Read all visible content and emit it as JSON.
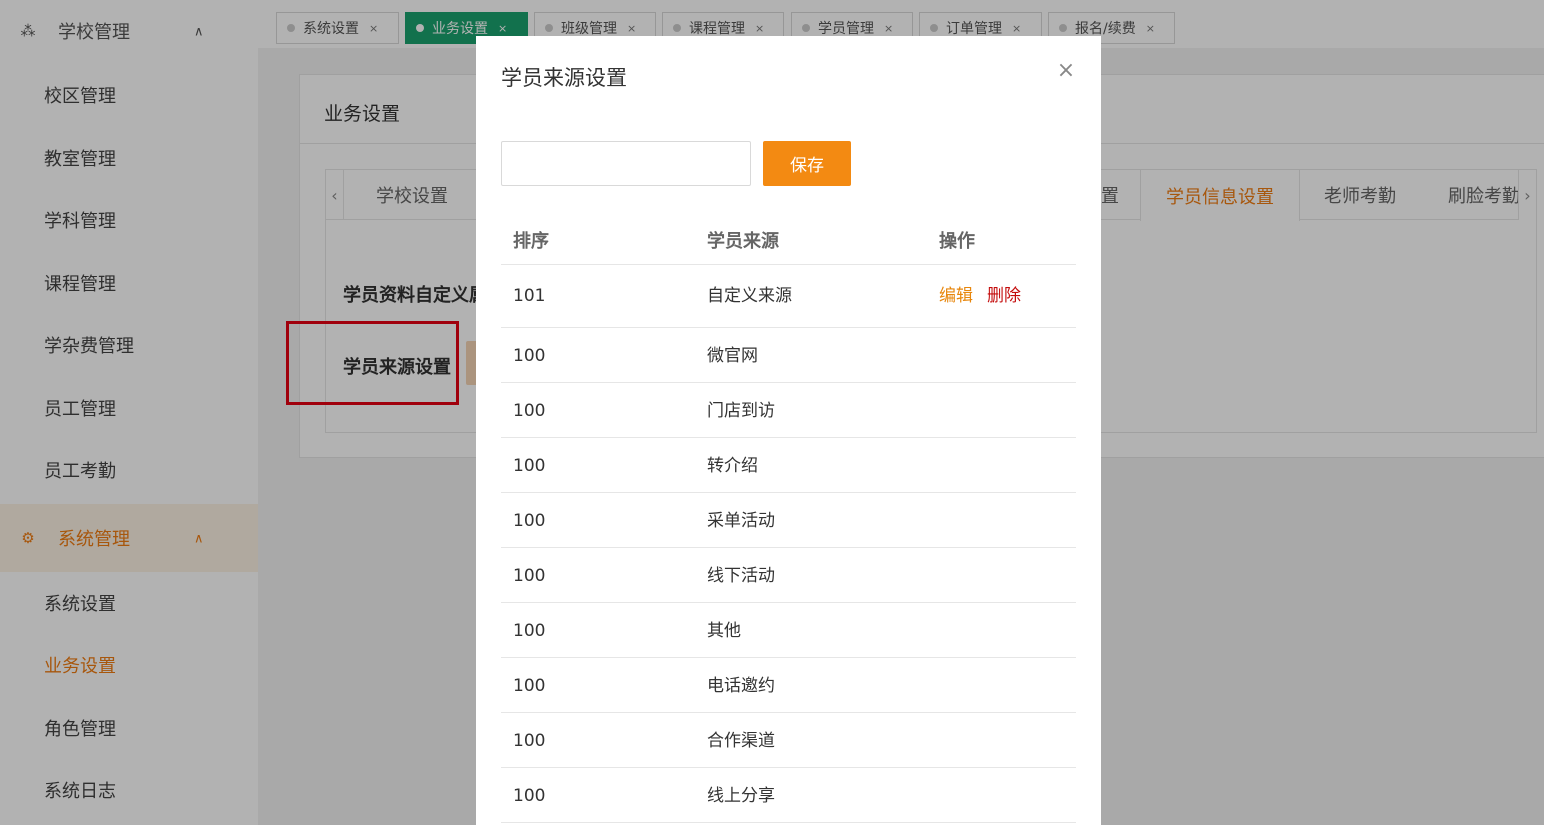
{
  "sidebar": {
    "school_group": {
      "icon": "sitemap-icon",
      "label": "学校管理"
    },
    "school_items": [
      {
        "label": "校区管理"
      },
      {
        "label": "教室管理"
      },
      {
        "label": "学科管理"
      },
      {
        "label": "课程管理"
      },
      {
        "label": "学杂费管理"
      },
      {
        "label": "员工管理"
      },
      {
        "label": "员工考勤"
      }
    ],
    "system_group": {
      "icon": "gear-icon",
      "label": "系统管理"
    },
    "system_items": [
      {
        "label": "系统设置"
      },
      {
        "label": "业务设置",
        "active": true
      },
      {
        "label": "角色管理"
      },
      {
        "label": "系统日志"
      }
    ]
  },
  "page_tabs": [
    {
      "label": "系统设置"
    },
    {
      "label": "业务设置",
      "active": true
    },
    {
      "label": "班级管理"
    },
    {
      "label": "课程管理"
    },
    {
      "label": "学员管理"
    },
    {
      "label": "订单管理"
    },
    {
      "label": "报名/续费"
    }
  ],
  "page_tab_close": "×",
  "card": {
    "title": "业务设置",
    "inner_tabs": {
      "scroll_left": "‹",
      "scroll_right": "›",
      "first": "学校设置",
      "partial": "置",
      "active": "学员信息设置",
      "teacher": "老师考勤",
      "face": "刷脸考勤"
    },
    "rows": {
      "custom_fields": "学员资料自定义属性",
      "source_settings": "学员来源设置"
    }
  },
  "modal": {
    "title": "学员来源设置",
    "close": "×",
    "input_value": "",
    "input_placeholder": "",
    "save_label": "保存",
    "table": {
      "headers": {
        "order": "排序",
        "source": "学员来源",
        "action": "操作"
      },
      "rows": [
        {
          "order": "101",
          "source": "自定义来源",
          "edit": "编辑",
          "delete": "删除"
        },
        {
          "order": "100",
          "source": "微官网"
        },
        {
          "order": "100",
          "source": "门店到访"
        },
        {
          "order": "100",
          "source": "转介绍"
        },
        {
          "order": "100",
          "source": "采单活动"
        },
        {
          "order": "100",
          "source": "线下活动"
        },
        {
          "order": "100",
          "source": "其他"
        },
        {
          "order": "100",
          "source": "电话邀约"
        },
        {
          "order": "100",
          "source": "合作渠道"
        },
        {
          "order": "100",
          "source": "线上分享"
        }
      ]
    }
  },
  "colors": {
    "accent_orange": "#f07d13",
    "save_button": "#f38a12",
    "active_tab_green": "#1aa36f",
    "delete_red": "#c40c0c",
    "highlight_red": "#e60012"
  }
}
